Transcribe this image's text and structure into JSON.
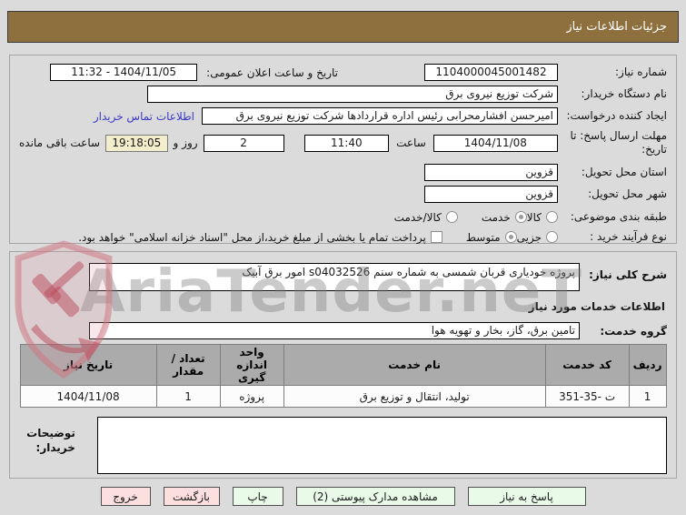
{
  "window": {
    "title": "جزئیات اطلاعات نیاز"
  },
  "watermark": {
    "text": "AriaTender.neT"
  },
  "form": {
    "need_number": {
      "label": "شماره نیاز:",
      "value": "1104000045001482"
    },
    "announce": {
      "label": "تاریخ و ساعت اعلان عمومی:",
      "value": "1404/11/05 - 11:32"
    },
    "buyer_org": {
      "label": "نام دستگاه خریدار:",
      "value": "شرکت توزیع نیروی برق"
    },
    "creator": {
      "label": "ایجاد کننده درخواست:",
      "value": "امیرحسن افشارمحرابی رئیس اداره قراردادها شرکت توزیع نیروی برق",
      "contact_link": "اطلاعات تماس خریدار"
    },
    "deadline": {
      "label": "مهلت ارسال پاسخ: تا تاریخ:",
      "date": "1404/11/08",
      "hour_label": "ساعت",
      "time": "11:40",
      "days": "2",
      "days_label": "روز و",
      "countdown": "19:18:05",
      "countdown_label": "ساعت باقی مانده"
    },
    "province": {
      "label": "استان محل تحویل:",
      "value": "قزوین"
    },
    "city": {
      "label": "شهر محل تحویل:",
      "value": "قزوین"
    },
    "category": {
      "label": "طبقه بندی موضوعی:",
      "options": [
        {
          "label": "کالا",
          "checked": false
        },
        {
          "label": "خدمت",
          "checked": true
        },
        {
          "label": "کالا/خدمت",
          "checked": false
        }
      ]
    },
    "process": {
      "label": "نوع فرآیند خرید :",
      "options": [
        {
          "label": "جزیی",
          "checked": false
        },
        {
          "label": "متوسط",
          "checked": true
        }
      ],
      "treasury_checkbox_label": "پرداخت تمام یا بخشی از مبلغ خرید،از محل \"اسناد خزانه اسلامی\" خواهد بود.",
      "treasury_checked": false
    }
  },
  "description": {
    "label": "شرح کلی نیاز:",
    "value": "پروژه خودیاری قربان شمسی به شماره سنم s04032526 امور برق آبیک"
  },
  "services": {
    "header": "اطلاعات خدمات مورد نیاز",
    "group": {
      "label": "گروه خدمت:",
      "value": "تامین برق، گاز، بخار و تهویه هوا"
    },
    "table": {
      "headers": [
        "ردیف",
        "کد خدمت",
        "نام خدمت",
        "واحد اندازه گیری",
        "تعداد / مقدار",
        "تاریخ نیاز"
      ],
      "rows": [
        {
          "row_no": "1",
          "service_code": "ت -35-351",
          "service_name": "تولید، انتقال و توزیع برق",
          "unit": "پروژه",
          "quantity": "1",
          "need_date": "1404/11/08"
        }
      ]
    }
  },
  "notes": {
    "label": "توضیحات خریدار:",
    "value": ""
  },
  "buttons": {
    "respond": "پاسخ به نیاز",
    "attachments": "مشاهده مدارک پیوستی (2)",
    "print": "چاپ",
    "back": "بازگشت",
    "exit": "خروج"
  },
  "colors": {
    "titlebar_bg": "#8e6f3e",
    "page_bg": "#dbdbdb",
    "countdown_bg": "#f2edcb",
    "button_green": "#e9fae9",
    "button_pink": "#fcdfdf",
    "table_header_bg": "#ababab",
    "link_blue": "#3a3ac9"
  }
}
